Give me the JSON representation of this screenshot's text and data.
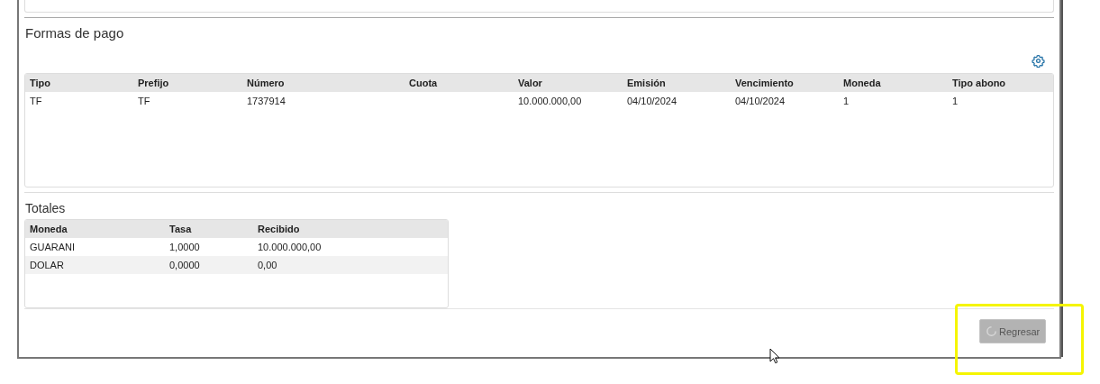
{
  "payments": {
    "title": "Formas de pago",
    "columns": [
      "Tipo",
      "Prefijo",
      "Número",
      "Cuota",
      "Valor",
      "Emisión",
      "Vencimiento",
      "Moneda",
      "Tipo abono"
    ],
    "rows": [
      [
        "TF",
        "TF",
        "1737914",
        "",
        "10.000.000,00",
        "04/10/2024",
        "04/10/2024",
        "1",
        "1"
      ]
    ]
  },
  "totals": {
    "title": "Totales",
    "columns": [
      "Moneda",
      "Tasa",
      "Recibido"
    ],
    "rows": [
      [
        "GUARANI",
        "1,0000",
        "10.000.000,00"
      ],
      [
        "DOLAR",
        "0,0000",
        "0,00"
      ]
    ]
  },
  "back_button": {
    "label": "Regresar",
    "loading": true
  }
}
